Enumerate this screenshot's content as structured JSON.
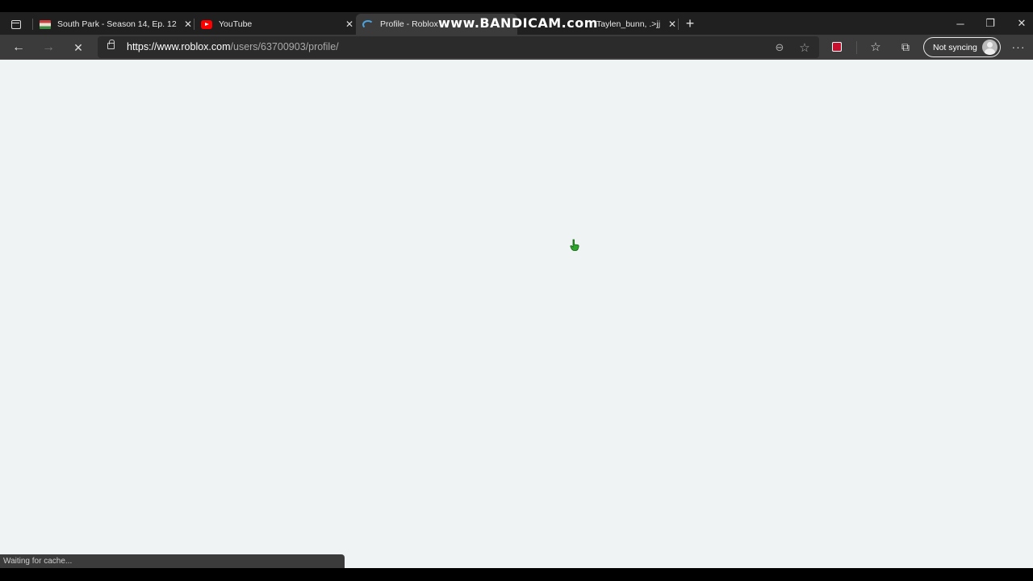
{
  "tabs": [
    {
      "title": "South Park - Season 14, Ep. 12 -",
      "favicon": "south-park-flag-icon",
      "active": false
    },
    {
      "title": "YouTube",
      "favicon": "youtube-icon",
      "active": false
    },
    {
      "title": "Profile - Roblox",
      "favicon": "loading-spinner-icon",
      "active": true
    },
    {
      "title": "Taylen_bunn, .>jj",
      "favicon": "",
      "active": false
    }
  ],
  "watermark": "www.BANDICAM.com",
  "address": {
    "url_host": "https://www.roblox.com",
    "url_path": "/users/63700903/profile/"
  },
  "profile": {
    "sync_label": "Not syncing"
  },
  "status": {
    "text": "Waiting for cache..."
  },
  "icons": {
    "close": "✕",
    "new_tab": "+",
    "minimize": "─",
    "restore": "❐",
    "back": "←",
    "forward": "→",
    "stop": "✕",
    "zoom": "⊖",
    "add_favorite": "☆",
    "favorites": "☆",
    "collections": "⧉",
    "more": "···"
  }
}
